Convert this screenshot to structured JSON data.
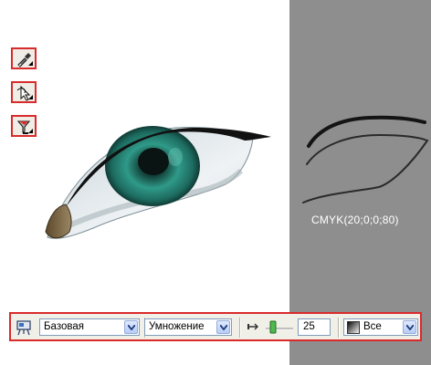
{
  "canvas": {
    "background_color": "#ffffff",
    "side_panel_color": "#8f8e8f"
  },
  "tools": [
    {
      "name": "eyedropper-tool",
      "icon": "eyedropper-icon"
    },
    {
      "name": "pick-tool",
      "icon": "arrow-cursor-icon"
    },
    {
      "name": "fill-tool",
      "icon": "funnel-fill-icon"
    }
  ],
  "color_swatch": {
    "label": "CMYK(20;0;0;80)"
  },
  "toolbar": {
    "preset_icon": "easel-icon",
    "preset_value": "Базовая",
    "blend_mode_value": "Умножение",
    "opacity_icon": "transparency-arrow-icon",
    "slider_icon": "slider-icon",
    "opacity_value": "25",
    "apply_to_icon": "gradient-swatch-icon",
    "apply_to_value": "Все"
  },
  "accent_colors": {
    "highlight_border": "#d92b2b",
    "iris": "#1f8a7a",
    "lid_line": "#111111"
  }
}
